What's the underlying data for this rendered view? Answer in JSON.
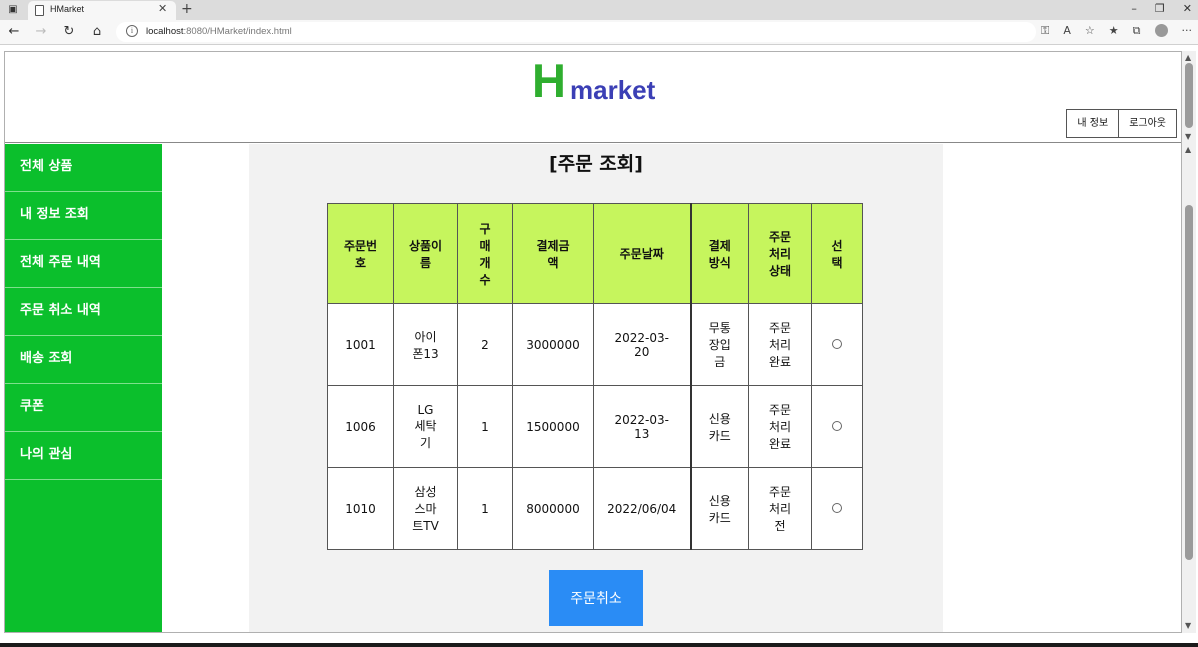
{
  "browser": {
    "tab_title": "HMarket",
    "url_host": "localhost",
    "url_rest": ":8080/HMarket/index.html"
  },
  "header": {
    "logo_h": "H",
    "logo_rest": "market",
    "my_info_button": "내 정보",
    "logout_button": "로그아웃"
  },
  "sidebar": {
    "items": [
      {
        "label": "전체 상품"
      },
      {
        "label": "내 정보 조회"
      },
      {
        "label": "전체 주문 내역"
      },
      {
        "label": "주문 취소 내역"
      },
      {
        "label": "배송 조회"
      },
      {
        "label": "쿠폰"
      },
      {
        "label": "나의 관심"
      }
    ]
  },
  "main": {
    "title": "[주문 조회]",
    "columns": [
      "주문번호",
      "상품이름",
      "구매개수",
      "결제금액",
      "주문날짜",
      "결제방식",
      "주문처리상태",
      "선택"
    ],
    "rows": [
      {
        "order_no": "1001",
        "product": "아이폰13",
        "qty": "2",
        "amount": "3000000",
        "date": "2022-03-20",
        "payment": "무통장입금",
        "status": "주문처리완료"
      },
      {
        "order_no": "1006",
        "product": "LG세탁기",
        "qty": "1",
        "amount": "1500000",
        "date": "2022-03-13",
        "payment": "신용카드",
        "status": "주문처리완료"
      },
      {
        "order_no": "1010",
        "product": "삼성스마트TV",
        "qty": "1",
        "amount": "8000000",
        "date": "2022/06/04",
        "payment": "신용카드",
        "status": "주문처리전"
      }
    ],
    "cancel_button": "주문취소"
  }
}
